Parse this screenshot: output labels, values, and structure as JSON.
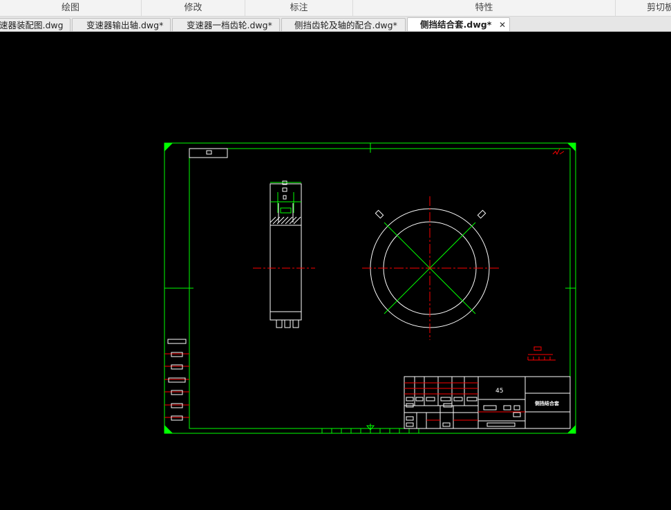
{
  "ribbon": {
    "groups": [
      {
        "label": "绘图"
      },
      {
        "label": "修改"
      },
      {
        "label": "标注"
      },
      {
        "label": "特性"
      },
      {
        "label": "剪切板"
      }
    ]
  },
  "tabs": [
    {
      "label": "速器装配图.dwg"
    },
    {
      "label": "变速器输出轴.dwg*"
    },
    {
      "label": "变速器一档齿轮.dwg*"
    },
    {
      "label": "侧挡齿轮及轴的配合.dwg*"
    },
    {
      "label": "侧挡结合套.dwg*",
      "active": true
    }
  ],
  "drawing": {
    "material": "45",
    "part_name": "侧挡结合套",
    "colors": {
      "background": "#000000",
      "frame": "#00ff00",
      "object": "#ffffff",
      "centerline": "#ff0000"
    }
  }
}
